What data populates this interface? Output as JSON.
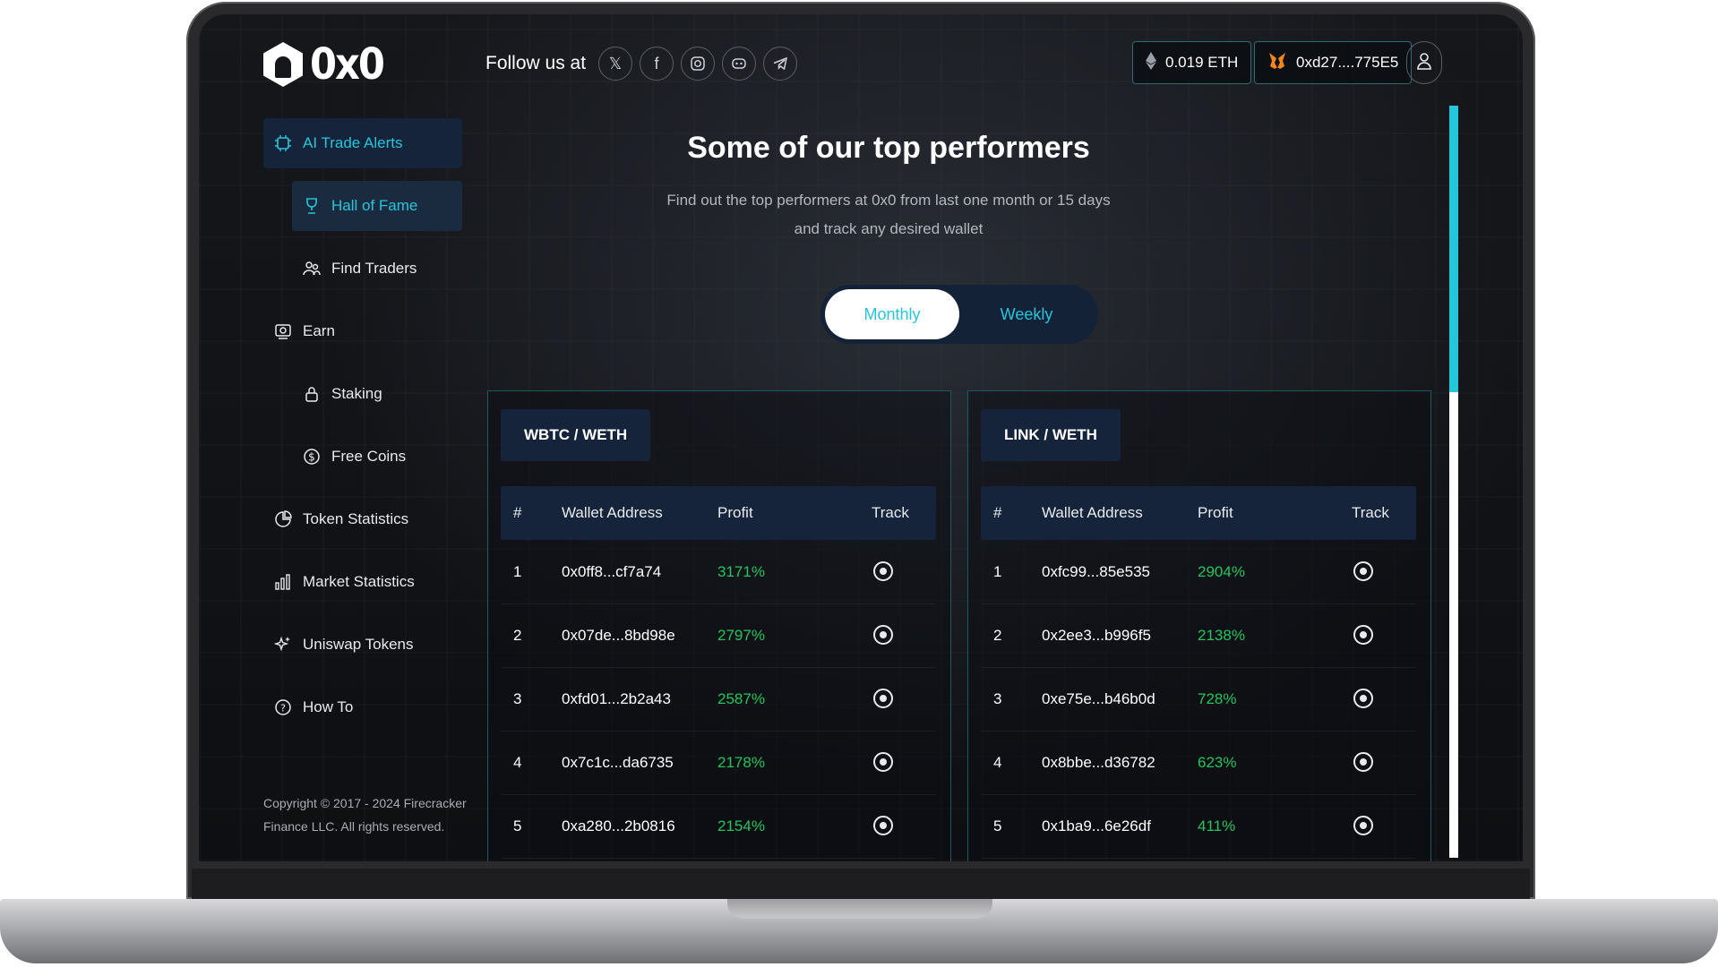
{
  "brand": {
    "logo_text": "0x0"
  },
  "sidebar": {
    "items": [
      {
        "label": "AI Trade Alerts",
        "icon": "chip-icon"
      },
      {
        "label": "Hall of Fame",
        "icon": "trophy-icon"
      },
      {
        "label": "Find Traders",
        "icon": "users-icon"
      },
      {
        "label": "Earn",
        "icon": "earn-icon"
      },
      {
        "label": "Staking",
        "icon": "lock-icon"
      },
      {
        "label": "Free Coins",
        "icon": "dollar-coin-icon"
      },
      {
        "label": "Token Statistics",
        "icon": "pie-chart-icon"
      },
      {
        "label": "Market Statistics",
        "icon": "bar-chart-icon"
      },
      {
        "label": "Uniswap Tokens",
        "icon": "sparkles-icon"
      },
      {
        "label": "How To",
        "icon": "help-circle-icon"
      }
    ],
    "copyright": "Copyright © 2017 - 2024 Firecracker Finance LLC. All rights reserved."
  },
  "topbar": {
    "follow_label": "Follow us at",
    "socials": [
      "x-icon",
      "facebook-icon",
      "instagram-icon",
      "discord-icon",
      "telegram-icon"
    ],
    "eth_balance": "0.019 ETH",
    "wallet": "0xd27....775E5"
  },
  "main": {
    "title": "Some of our top performers",
    "subtitle": "Find out the top performers at 0x0 from last one month or 15 days and track any desired wallet",
    "toggle": {
      "monthly": "Monthly",
      "weekly": "Weekly",
      "selected": "Monthly"
    },
    "table_headers": {
      "num": "#",
      "wallet": "Wallet Address",
      "profit": "Profit",
      "track": "Track"
    },
    "cards": [
      {
        "pair": "WBTC / WETH",
        "rows": [
          {
            "num": "1",
            "wallet": "0x0ff8...cf7a74",
            "profit": "3171%"
          },
          {
            "num": "2",
            "wallet": "0x07de...8bd98e",
            "profit": "2797%"
          },
          {
            "num": "3",
            "wallet": "0xfd01...2b2a43",
            "profit": "2587%"
          },
          {
            "num": "4",
            "wallet": "0x7c1c...da6735",
            "profit": "2178%"
          },
          {
            "num": "5",
            "wallet": "0xa280...2b0816",
            "profit": "2154%"
          }
        ]
      },
      {
        "pair": "LINK / WETH",
        "rows": [
          {
            "num": "1",
            "wallet": "0xfc99...85e535",
            "profit": "2904%"
          },
          {
            "num": "2",
            "wallet": "0x2ee3...b996f5",
            "profit": "2138%"
          },
          {
            "num": "3",
            "wallet": "0xe75e...b46b0d",
            "profit": "728%"
          },
          {
            "num": "4",
            "wallet": "0x8bbe...d36782",
            "profit": "623%"
          },
          {
            "num": "5",
            "wallet": "0x1ba9...6e26df",
            "profit": "411%"
          }
        ]
      }
    ]
  },
  "colors": {
    "accent": "#26c6da",
    "profit": "#22c55e",
    "panel": "#15243a"
  }
}
